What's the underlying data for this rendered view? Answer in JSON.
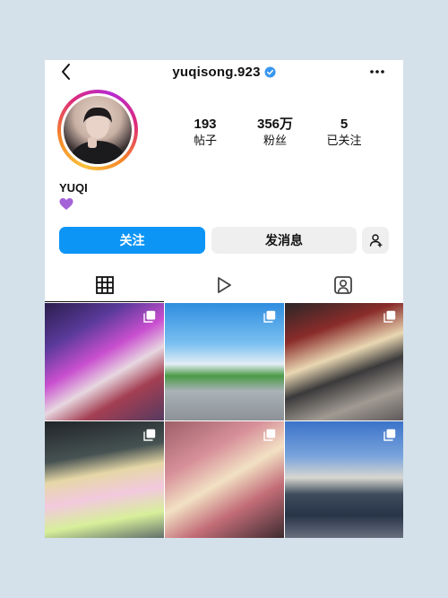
{
  "header": {
    "username": "yuqisong.923",
    "back_icon": "chevron-left-icon",
    "verified_icon": "verified-badge-icon",
    "more_icon": "more-horizontal-icon"
  },
  "profile": {
    "stats": [
      {
        "value": "193",
        "label": "帖子"
      },
      {
        "value": "356万",
        "label": "粉丝"
      },
      {
        "value": "5",
        "label": "已关注"
      }
    ],
    "display_name": "YUQI",
    "bio_emoji": "purple-heart-icon"
  },
  "actions": {
    "follow_label": "关注",
    "message_label": "发消息",
    "add_user_icon": "person-add-icon"
  },
  "tabs": [
    {
      "icon": "grid-icon",
      "active": true
    },
    {
      "icon": "reels-play-icon",
      "active": false
    },
    {
      "icon": "tagged-person-icon",
      "active": false
    }
  ],
  "posts": [
    {
      "type": "multi-photo"
    },
    {
      "type": "multi-photo"
    },
    {
      "type": "multi-photo"
    },
    {
      "type": "multi-photo"
    },
    {
      "type": "multi-photo"
    },
    {
      "type": "multi-photo"
    }
  ],
  "colors": {
    "background": "#d4e1ea",
    "accent_blue": "#0d95f6",
    "secondary_button": "#efefef",
    "verified_blue": "#3897f0",
    "bio_heart": "#a462d9"
  }
}
